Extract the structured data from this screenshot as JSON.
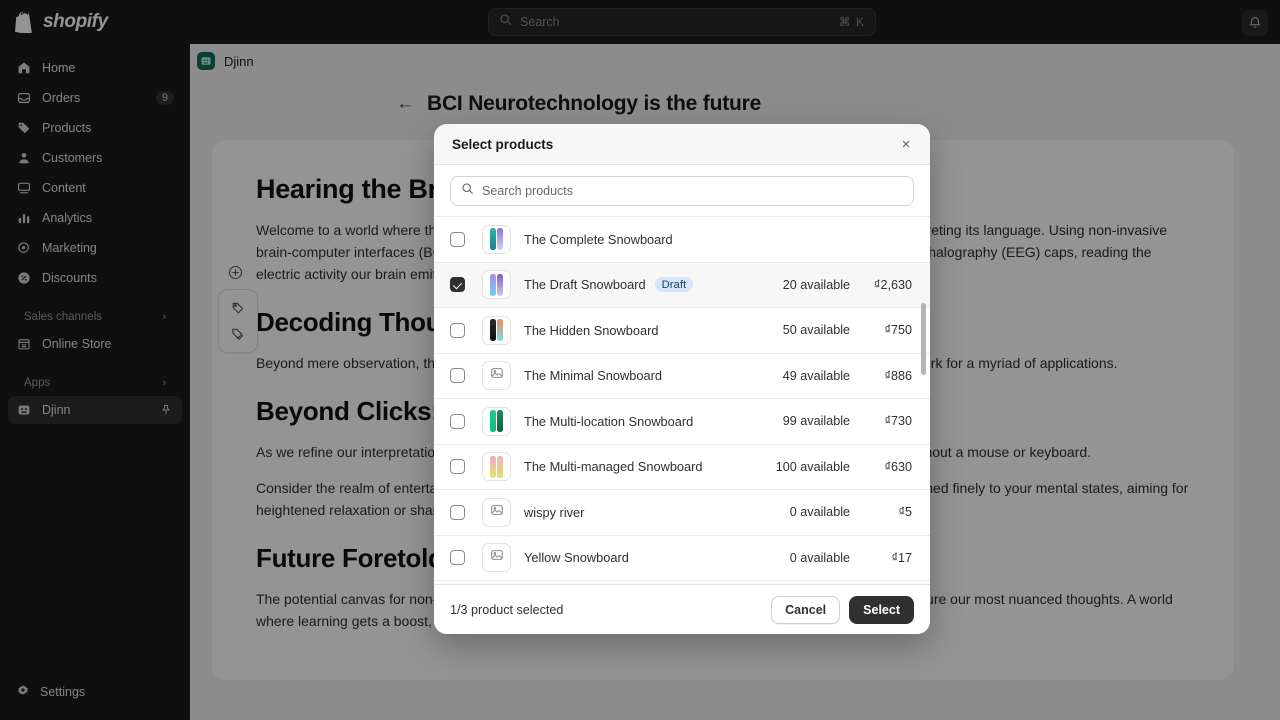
{
  "topbar": {
    "brand": "shopify",
    "search_placeholder": "Search",
    "search_shortcut": "⌘ K",
    "notifications_label": "Notifications"
  },
  "sidebar": {
    "items": [
      {
        "label": "Home",
        "icon": "home-icon",
        "badge": ""
      },
      {
        "label": "Orders",
        "icon": "orders-icon",
        "badge": "9"
      },
      {
        "label": "Products",
        "icon": "products-icon",
        "badge": ""
      },
      {
        "label": "Customers",
        "icon": "customers-icon",
        "badge": ""
      },
      {
        "label": "Content",
        "icon": "content-icon",
        "badge": ""
      },
      {
        "label": "Analytics",
        "icon": "analytics-icon",
        "badge": ""
      },
      {
        "label": "Marketing",
        "icon": "marketing-icon",
        "badge": ""
      },
      {
        "label": "Discounts",
        "icon": "discounts-icon",
        "badge": ""
      }
    ],
    "sales_channels_header": "Sales channels",
    "sales_channels": [
      {
        "label": "Online Store",
        "icon": "store-icon"
      }
    ],
    "apps_header": "Apps",
    "apps": [
      {
        "label": "Djinn",
        "icon": "djinn-app-icon",
        "pinned": true
      }
    ],
    "settings_label": "Settings"
  },
  "main": {
    "app_breadcrumb": "Djinn",
    "page_title": "BCI Neurotechnology is the future",
    "article": {
      "heading_1": "Hearing the Brain's Whispers",
      "paragraph_1": "Welcome to a world where thought itself becomes a tool. Recent years have seen significant strides in interpreting its language. Using non-invasive brain-computer interfaces (BCIs), we're capturing the brain's whispers without a single incision. Electroencephalography (EEG) caps, reading the electric activity our brain emits, are at the heart of this technology.",
      "heading_2": "Decoding Thought: Interpreting Brainwaves.",
      "paragraph_2": "Beyond mere observation, these captured brainwaves are decoded into actionable data, laying the groundwork for a myriad of applications.",
      "heading_3": "Beyond Clicks: A New Interface",
      "paragraph_3": "As we refine our interpretation of brainwaves, we edge closer to a renewed interaction—imagine working without a mouse or keyboard.",
      "paragraph_4": "Consider the realm of entertainment: video games respond to your mood shifts, or meditation applications tuned finely to your mental states, aiming for heightened relaxation or sharpened focus.",
      "heading_4": "Future Foretold: What Lies Ahead?",
      "paragraph_5": "The potential canvas for non-invasive BCI is vast. Imagine interfaces refined to such an extent that they capture our most nuanced thoughts. A world where learning gets a boost, memories become more vivid, and shared experiences take on a"
    },
    "editor_tools": {
      "add_block": "add-block-icon",
      "tag_1": "tag-icon",
      "tag_2": "tags-icon"
    }
  },
  "modal": {
    "title": "Select products",
    "close_label": "×",
    "search_placeholder": "Search products",
    "rows": [
      {
        "name": "The Complete Snowboard",
        "badge": "",
        "available": "",
        "price": "",
        "thumb": "boards",
        "colors": [
          "#2fb7a5",
          "#8f6fd4"
        ],
        "checked": false
      },
      {
        "name": "The Draft Snowboard",
        "badge": "Draft",
        "available": "20 available",
        "price": "₫2,630",
        "thumb": "boards",
        "colors": [
          "#6ad0f0",
          "#b08ce8"
        ],
        "checked": true
      },
      {
        "name": "The Hidden Snowboard",
        "badge": "",
        "available": "50 available",
        "price": "₫750",
        "thumb": "boards",
        "colors": [
          "#232323",
          "#f08a60"
        ],
        "checked": false
      },
      {
        "name": "The Minimal Snowboard",
        "badge": "",
        "available": "49 available",
        "price": "₫886",
        "thumb": "placeholder",
        "colors": [],
        "checked": false
      },
      {
        "name": "The Multi-location Snowboard",
        "badge": "",
        "available": "99 available",
        "price": "₫730",
        "thumb": "boards",
        "colors": [
          "#17d08f",
          "#1f8f5e"
        ],
        "checked": false
      },
      {
        "name": "The Multi-managed Snowboard",
        "badge": "",
        "available": "100 available",
        "price": "₫630",
        "thumb": "boards",
        "colors": [
          "#f2a8c0",
          "#d9e05a"
        ],
        "checked": false
      },
      {
        "name": "wispy river",
        "badge": "",
        "available": "0 available",
        "price": "₫5",
        "thumb": "placeholder",
        "colors": [],
        "checked": false
      },
      {
        "name": "Yellow Snowboard",
        "badge": "",
        "available": "0 available",
        "price": "₫17",
        "thumb": "placeholder",
        "colors": [],
        "checked": false
      }
    ],
    "footer_status": "1/3 product selected",
    "cancel_label": "Cancel",
    "select_label": "Select"
  },
  "colors": {
    "accent_dark": "#303030",
    "draft_badge_bg": "#d8e6fb",
    "draft_badge_fg": "#1b3e6b",
    "topbar_bg": "#1a1a1a",
    "page_bg": "#f1f1f1"
  }
}
